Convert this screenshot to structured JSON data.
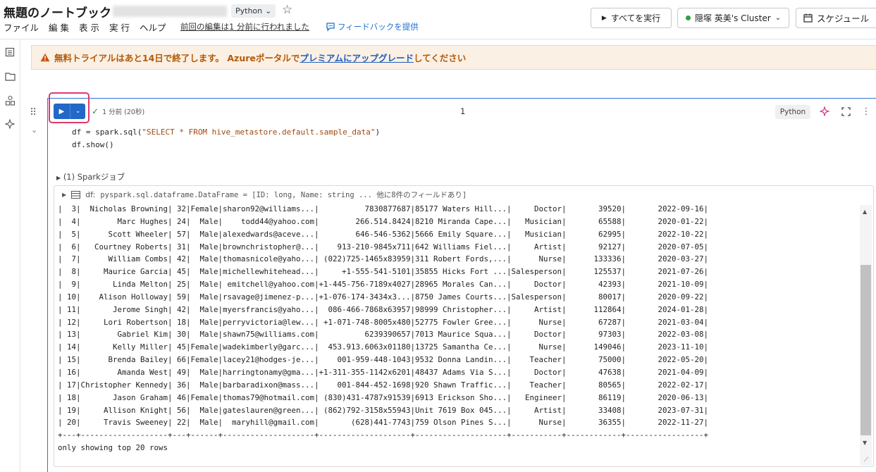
{
  "header": {
    "title": "無題のノートブック",
    "language": "Python",
    "menus": [
      "ファイル",
      "編 集",
      "表 示",
      "実 行",
      "ヘルプ"
    ],
    "last_edit": "前回の編集は1 分前に行われました",
    "feedback": "フィードバックを提供",
    "run_all": "すべてを実行",
    "cluster": "隠塚 英美's Cluster",
    "schedule": "スケジュール"
  },
  "banner": {
    "prefix": "無料トライアルはあと14日で終了します。 Azureポータルで",
    "link": "プレミアムにアップグレード",
    "suffix": "してください"
  },
  "cell": {
    "status": "1 分前 (20秒)",
    "number": "1",
    "language_tag": "Python",
    "code": {
      "line1_pre": "df = spark.sql(",
      "line1_str": "\"SELECT * FROM hive_metastore.default.sample_data\"",
      "line1_post": ")",
      "line2": "df.show()"
    },
    "jobs": "(1) Sparkジョブ",
    "df_label": "df:",
    "df_type": "pyspark.sql.dataframe.DataFrame = [ID: long, Name: string ... 他に8件のフィールドあり]",
    "rows": [
      [
        "3",
        "Nicholas Browning",
        "32",
        "Female",
        "sharon92@williams...",
        "7830877687",
        "85177 Waters Hill...",
        "Doctor",
        "39520",
        "2022-09-16"
      ],
      [
        "4",
        "Marc Hughes",
        "24",
        "Male",
        "todd44@yahoo.com",
        "266.514.8424",
        "8210 Miranda Cape...",
        "Musician",
        "65588",
        "2020-01-22"
      ],
      [
        "5",
        "Scott Wheeler",
        "57",
        "Male",
        "alexedwards@aceve...",
        "646-546-5362",
        "5666 Emily Square...",
        "Musician",
        "62995",
        "2022-10-22"
      ],
      [
        "6",
        "Courtney Roberts",
        "31",
        "Male",
        "brownchristopher@...",
        "913-210-9845x711",
        "642 Williams Fiel...",
        "Artist",
        "92127",
        "2020-07-05"
      ],
      [
        "7",
        "William Combs",
        "42",
        "Male",
        "thomasnicole@yaho...",
        "(022)725-1465x83959",
        "311 Robert Fords,...",
        "Nurse",
        "133336",
        "2020-03-27"
      ],
      [
        "8",
        "Maurice Garcia",
        "45",
        "Male",
        "michellewhitehead...",
        "+1-555-541-5101",
        "35855 Hicks Fort ...",
        "Salesperson",
        "125537",
        "2021-07-26"
      ],
      [
        "9",
        "Linda Melton",
        "25",
        "Male",
        "emitchell@yahoo.com",
        "+1-445-756-7189x4027",
        "28965 Morales Can...",
        "Doctor",
        "42393",
        "2021-10-09"
      ],
      [
        "10",
        "Alison Holloway",
        "59",
        "Male",
        "rsavage@jimenez-p...",
        "+1-076-174-3434x3...",
        "8750 James Courts...",
        "Salesperson",
        "80017",
        "2020-09-22"
      ],
      [
        "11",
        "Jerome Singh",
        "42",
        "Male",
        "myersfrancis@yaho...",
        "086-466-7868x63957",
        "98999 Christopher...",
        "Artist",
        "112864",
        "2024-01-28"
      ],
      [
        "12",
        "Lori Robertson",
        "18",
        "Male",
        "perryvictoria@lew...",
        "+1-071-748-8005x480",
        "52775 Fowler Gree...",
        "Nurse",
        "67287",
        "2021-03-04"
      ],
      [
        "13",
        "Gabriel Kim",
        "30",
        "Male",
        "shawn75@williams.com",
        "6239390657",
        "7013 Maurice Squa...",
        "Doctor",
        "97303",
        "2022-03-08"
      ],
      [
        "14",
        "Kelly Miller",
        "45",
        "Female",
        "wadekimberly@garc...",
        "453.913.6063x01180",
        "13725 Samantha Ce...",
        "Nurse",
        "149046",
        "2023-11-10"
      ],
      [
        "15",
        "Brenda Bailey",
        "66",
        "Female",
        "lacey21@hodges-je...",
        "001-959-448-1043",
        "9532 Donna Landin...",
        "Teacher",
        "75000",
        "2022-05-20"
      ],
      [
        "16",
        "Amanda West",
        "49",
        "Male",
        "harringtonamy@gma...",
        "+1-311-355-1142x6201",
        "48437 Adams Via S...",
        "Doctor",
        "47638",
        "2021-04-09"
      ],
      [
        "17",
        "Christopher Kennedy",
        "36",
        "Male",
        "barbaradixon@mass...",
        "001-844-452-1698",
        "920 Shawn Traffic...",
        "Teacher",
        "80565",
        "2022-02-17"
      ],
      [
        "18",
        "Jason Graham",
        "46",
        "Female",
        "thomas79@hotmail.com",
        "(830)431-4787x91539",
        "6913 Erickson Sho...",
        "Engineer",
        "86119",
        "2020-06-13"
      ],
      [
        "19",
        "Allison Knight",
        "56",
        "Male",
        "gateslauren@green...",
        "(862)792-3158x55943",
        "Unit 7619 Box 045...",
        "Artist",
        "33408",
        "2023-07-31"
      ],
      [
        "20",
        "Travis Sweeney",
        "22",
        "Male",
        "maryhill@gmail.com",
        "(628)441-7743",
        "759 Olson Pines S...",
        "Nurse",
        "36355",
        "2022-11-27"
      ]
    ],
    "footer": "only showing top 20 rows"
  }
}
